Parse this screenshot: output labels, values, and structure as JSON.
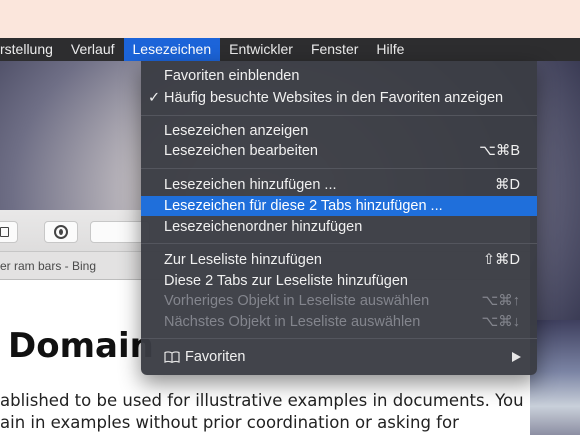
{
  "menubar": {
    "items": [
      {
        "label": "rstellung"
      },
      {
        "label": "Verlauf"
      },
      {
        "label": "Lesezeichen"
      },
      {
        "label": "Entwickler"
      },
      {
        "label": "Fenster"
      },
      {
        "label": "Hilfe"
      }
    ]
  },
  "menu": {
    "items": [
      {
        "label": "Favoriten einblenden"
      },
      {
        "label": "Häufig besuchte Websites in den Favoriten anzeigen",
        "check": "✓"
      },
      {
        "label": "Lesezeichen anzeigen"
      },
      {
        "label": "Lesezeichen bearbeiten",
        "shortcut": "⌥⌘B"
      },
      {
        "label": "Lesezeichen hinzufügen ...",
        "shortcut": "⌘D"
      },
      {
        "label": "Lesezeichen für diese 2 Tabs hinzufügen ..."
      },
      {
        "label": "Lesezeichenordner hinzufügen"
      },
      {
        "label": "Zur Leseliste hinzufügen",
        "shortcut": "⇧⌘D"
      },
      {
        "label": "Diese 2 Tabs zur Leseliste hinzufügen"
      },
      {
        "label": "Vorheriges Objekt in Leseliste auswählen",
        "shortcut": "⌥⌘↑"
      },
      {
        "label": "Nächstes Objekt in Leseliste auswählen",
        "shortcut": "⌥⌘↓"
      },
      {
        "label": "Favoriten"
      }
    ]
  },
  "browser": {
    "tab_title": "er ram bars - Bing",
    "heading": "Domain",
    "paragraph": [
      "ablished to be used for illustrative examples in documents. You",
      "ain in examples without prior coordination or asking for"
    ]
  },
  "colors": {
    "menubar_bg": "#2d2d2f",
    "menu_bg": "#3a3c44",
    "highlight": "#1f6fdb",
    "disabled_text": "#83858d"
  },
  "icons": {
    "check": "checkmark-icon",
    "favorites": "book-icon",
    "submenu": "chevron-right-icon"
  }
}
